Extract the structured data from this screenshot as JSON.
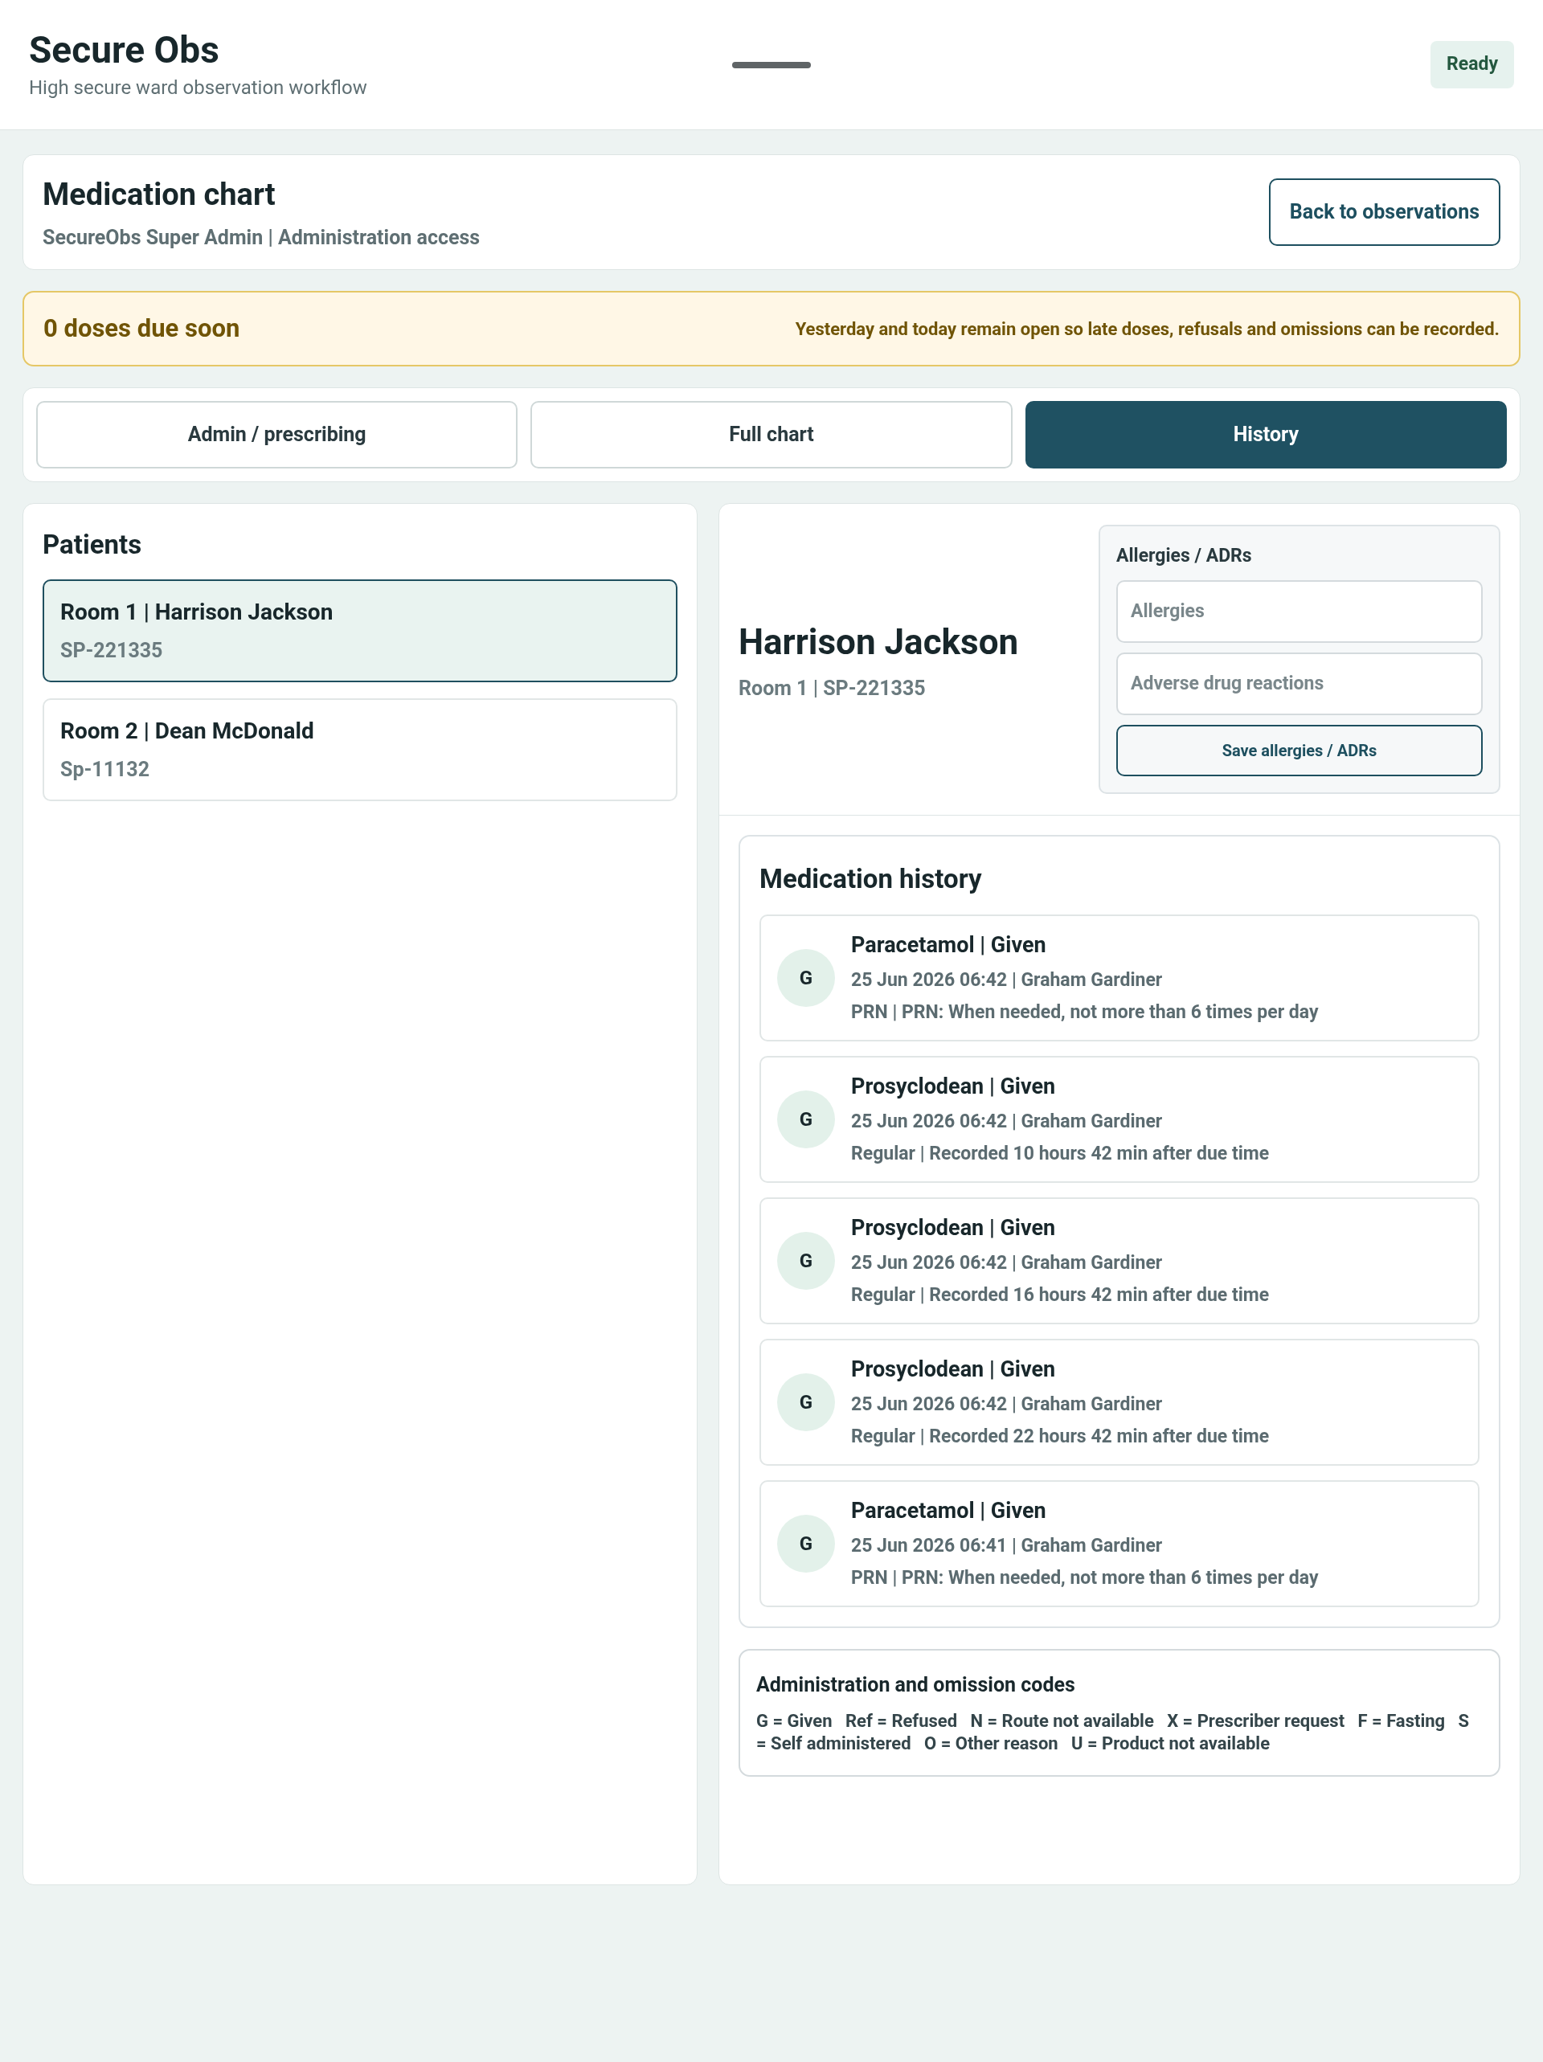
{
  "header": {
    "title": "Secure Obs",
    "subtitle": "High secure ward observation workflow",
    "status": "Ready"
  },
  "chart_header": {
    "title": "Medication chart",
    "subtitle": "SecureObs Super Admin | Administration access",
    "back_button": "Back to observations"
  },
  "alert": {
    "title": "0 doses due soon",
    "message": "Yesterday and today remain open so late doses, refusals and omissions can be recorded."
  },
  "tabs": [
    {
      "label": "Admin / prescribing",
      "selected": false
    },
    {
      "label": "Full chart",
      "selected": false
    },
    {
      "label": "History",
      "selected": true
    }
  ],
  "patients": {
    "title": "Patients",
    "items": [
      {
        "name": "Room 1 | Harrison Jackson",
        "id": "SP-221335",
        "selected": true
      },
      {
        "name": "Room 2 | Dean McDonald",
        "id": "Sp-11132",
        "selected": false
      }
    ]
  },
  "patient_detail": {
    "name": "Harrison Jackson",
    "subtitle": "Room 1 | SP-221335"
  },
  "allergies": {
    "title": "Allergies / ADRs",
    "allergies_placeholder": "Allergies",
    "adr_placeholder": "Adverse drug reactions",
    "save_button": "Save allergies / ADRs"
  },
  "history": {
    "title": "Medication history",
    "items": [
      {
        "code": "G",
        "title": "Paracetamol | Given",
        "when": "25 Jun 2026 06:42 | Graham Gardiner",
        "detail": "PRN | PRN: When needed, not more than 6 times per day"
      },
      {
        "code": "G",
        "title": "Prosyclodean | Given",
        "when": "25 Jun 2026 06:42 | Graham Gardiner",
        "detail": "Regular | Recorded 10 hours 42 min after due time"
      },
      {
        "code": "G",
        "title": "Prosyclodean | Given",
        "when": "25 Jun 2026 06:42 | Graham Gardiner",
        "detail": "Regular | Recorded 16 hours 42 min after due time"
      },
      {
        "code": "G",
        "title": "Prosyclodean | Given",
        "when": "25 Jun 2026 06:42 | Graham Gardiner",
        "detail": "Regular | Recorded 22 hours 42 min after due time"
      },
      {
        "code": "G",
        "title": "Paracetamol | Given",
        "when": "25 Jun 2026 06:41 | Graham Gardiner",
        "detail": "PRN | PRN: When needed, not more than 6 times per day"
      }
    ]
  },
  "codes": {
    "title": "Administration and omission codes",
    "text": "G = Given   Ref = Refused   N = Route not available   X = Prescriber request   F = Fasting   S = Self administered   O = Other reason   U = Product not available"
  }
}
